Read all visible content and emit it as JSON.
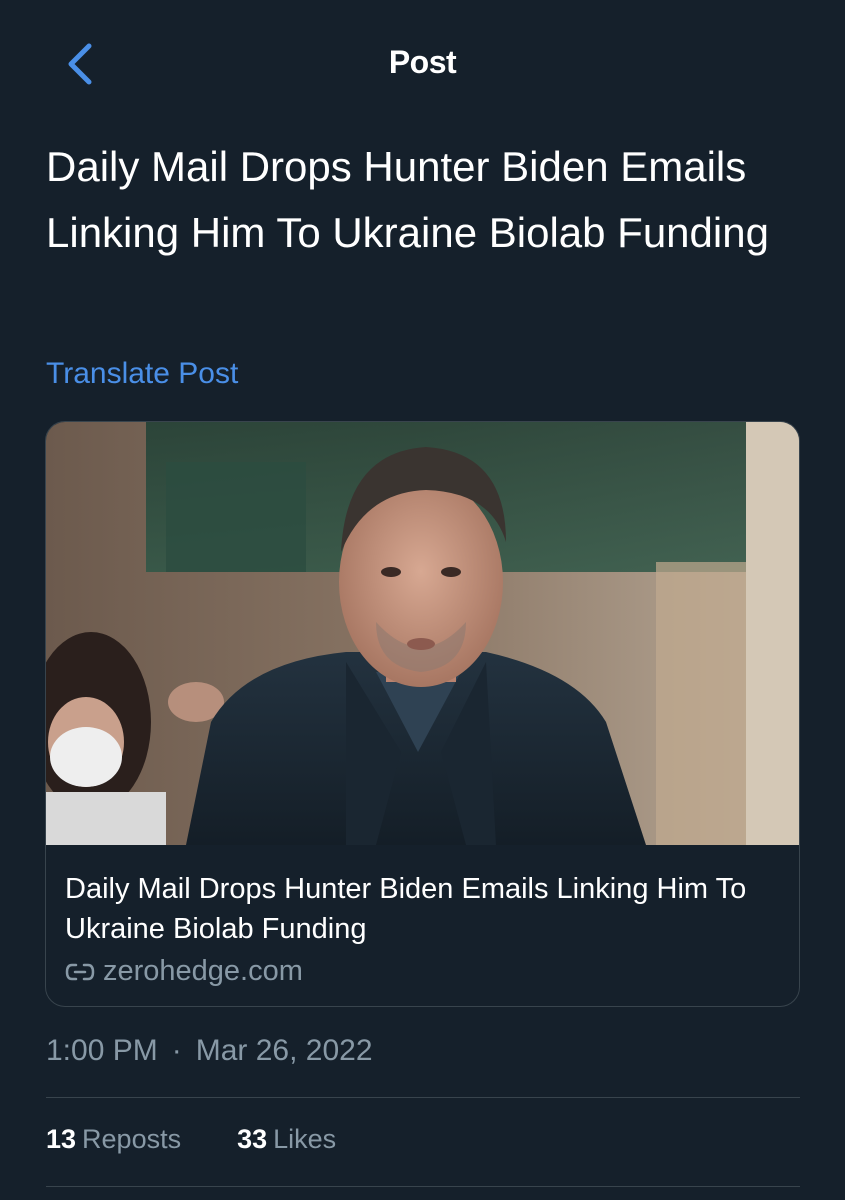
{
  "header": {
    "title": "Post",
    "back_icon": "chevron-left-icon",
    "accent_color": "#4a8fe7"
  },
  "post": {
    "text": "Daily Mail Drops Hunter Biden Emails Linking Him To Ukraine Biolab Funding",
    "translate_label": "Translate Post"
  },
  "card": {
    "image_description_icon": "photo",
    "title": "Daily Mail Drops Hunter Biden Emails Linking Him To Ukraine Biolab Funding",
    "domain": "zerohedge.com",
    "domain_icon": "link-icon"
  },
  "meta": {
    "time": "1:00 PM",
    "separator": "·",
    "date": "Mar 26, 2022"
  },
  "stats": {
    "reposts_count": "13",
    "reposts_label": "Reposts",
    "likes_count": "33",
    "likes_label": "Likes"
  }
}
